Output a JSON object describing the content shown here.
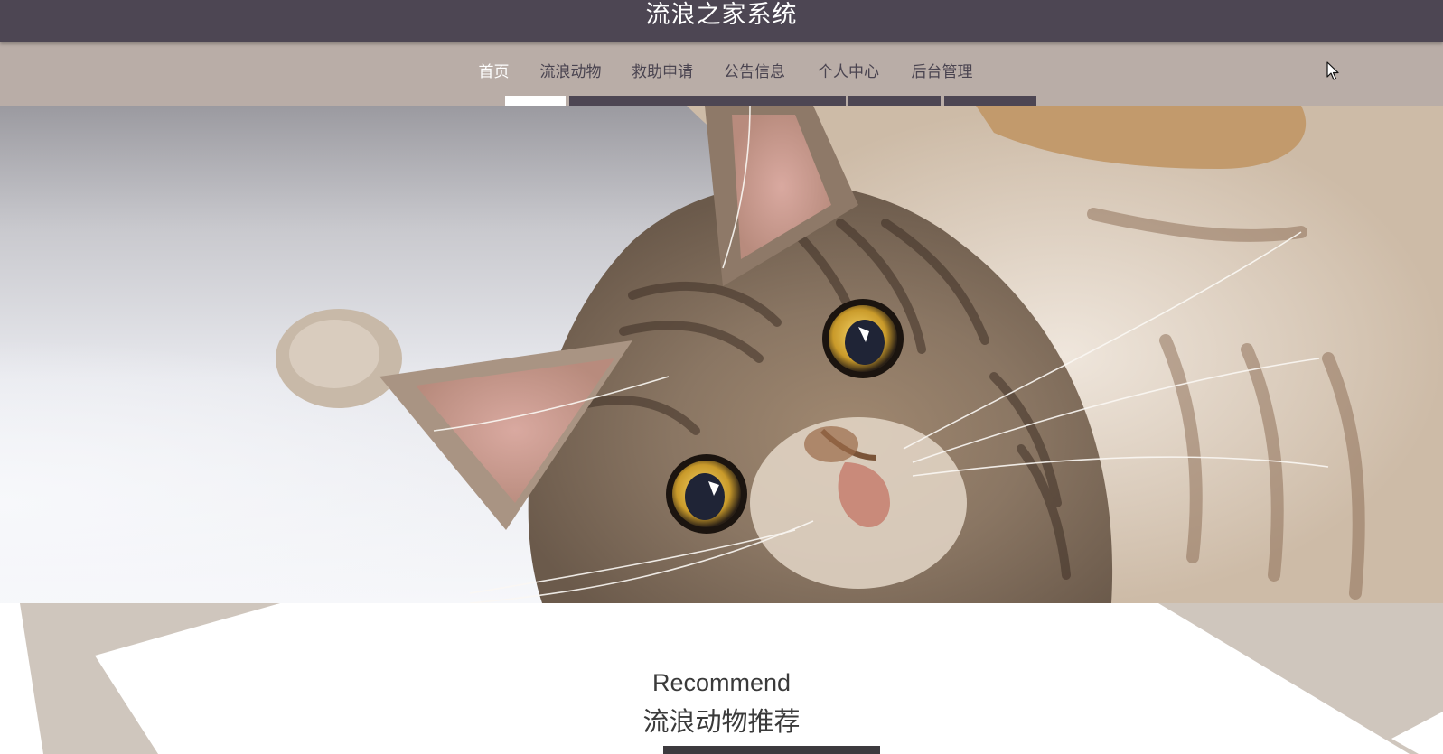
{
  "header": {
    "site_title": "流浪之家系统"
  },
  "nav": {
    "items": [
      {
        "label": "首页",
        "active": true
      },
      {
        "label": "流浪动物",
        "active": false
      },
      {
        "label": "救助申请",
        "active": false
      },
      {
        "label": "公告信息",
        "active": false
      },
      {
        "label": "个人中心",
        "active": false
      },
      {
        "label": "后台管理",
        "active": false
      }
    ]
  },
  "carousel": {
    "slide_count": 3,
    "active_slide": 2,
    "image": "cat-photo"
  },
  "recommend": {
    "title_en": "Recommend",
    "title_cn": "流浪动物推荐"
  },
  "colors": {
    "header_bg": "#4d4653",
    "nav_bg": "#b9ada7",
    "accent_beige": "#cfc6bd",
    "text_dark": "#3a3a3a"
  }
}
